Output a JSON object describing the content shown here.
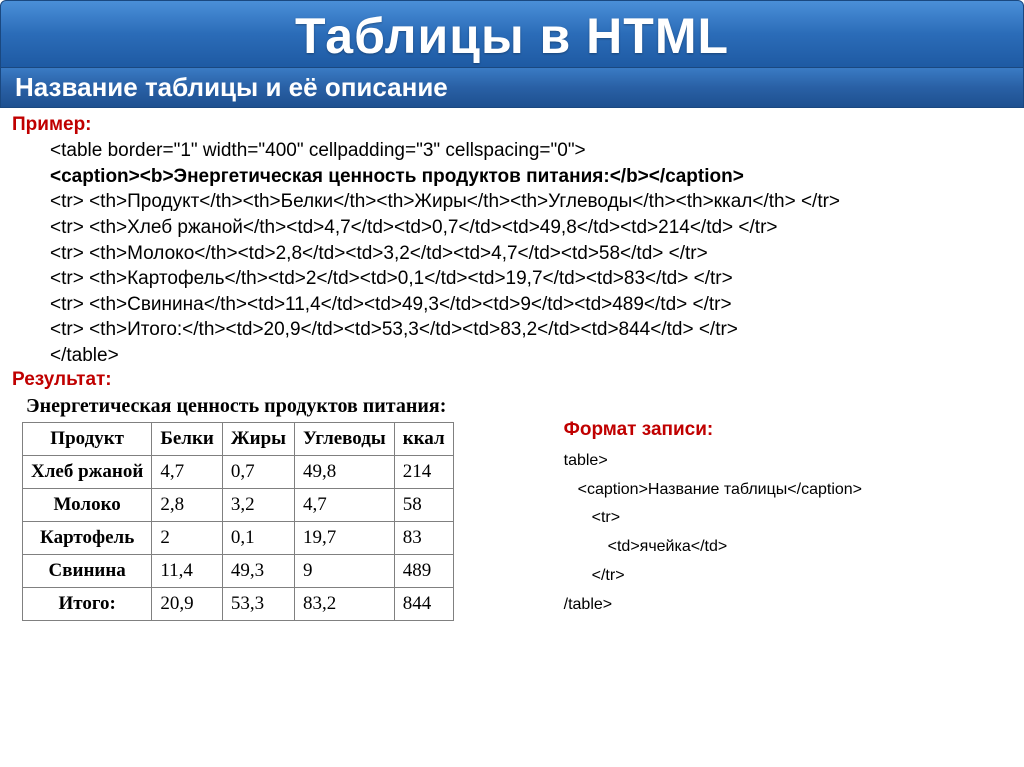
{
  "title": "Таблицы в HTML",
  "subtitle": "Название таблицы и её описание",
  "example_label": "Пример:",
  "result_label": "Результат:",
  "format_label": "Формат записи:",
  "code": {
    "l1": "<table border=\"1\" width=\"400\" cellpadding=\"3\" cellspacing=\"0\">",
    "l2": "<caption><b>Энергетическая ценность продуктов питания:</b></caption>",
    "l3": "<tr> <th>Продукт</th><th>Белки</th><th>Жиры</th><th>Углеводы</th><th>ккал</th> </tr>",
    "l4": "<tr> <th>Хлеб ржаной</th><td>4,7</td><td>0,7</td><td>49,8</td><td>214</td> </tr>",
    "l5": "<tr> <th>Молоко</th><td>2,8</td><td>3,2</td><td>4,7</td><td>58</td> </tr>",
    "l6": "<tr> <th>Картофель</th><td>2</td><td>0,1</td><td>19,7</td><td>83</td> </tr>",
    "l7": "<tr> <th>Свинина</th><td>11,4</td><td>49,3</td><td>9</td><td>489</td> </tr>",
    "l8": "<tr> <th>Итого:</th><td>20,9</td><td>53,3</td><td>83,2</td><td>844</td> </tr>",
    "l9": "</table>"
  },
  "table": {
    "caption": "Энергетическая ценность продуктов питания:",
    "headers": [
      "Продукт",
      "Белки",
      "Жиры",
      "Углеводы",
      "ккал"
    ],
    "rows": [
      {
        "h": "Хлеб ржаной",
        "c": [
          "4,7",
          "0,7",
          "49,8",
          "214"
        ]
      },
      {
        "h": "Молоко",
        "c": [
          "2,8",
          "3,2",
          "4,7",
          "58"
        ]
      },
      {
        "h": "Картофель",
        "c": [
          "2",
          "0,1",
          "19,7",
          "83"
        ]
      },
      {
        "h": "Свинина",
        "c": [
          "11,4",
          "49,3",
          "9",
          "489"
        ]
      },
      {
        "h": "Итого:",
        "c": [
          "20,9",
          "53,3",
          "83,2",
          "844"
        ]
      }
    ]
  },
  "format": {
    "l1": "table>",
    "l2": "<caption>Название таблицы</caption>",
    "l3": "<tr>",
    "l4": "<td>ячейка</td>",
    "l5": "</tr>",
    "l6": "/table>"
  }
}
